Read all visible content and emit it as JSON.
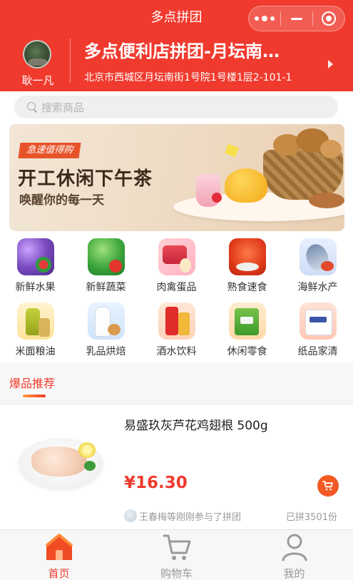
{
  "header": {
    "title": "多点拼团",
    "leader_name": "耿一凡",
    "shop_name": "多点便利店拼团-月坛南…",
    "address": "北京市西城区月坛南街1号院1号楼1层2-101-1"
  },
  "search": {
    "placeholder": "搜索商品"
  },
  "banner": {
    "tag": "急速值得购",
    "headline": "开工休闲下午茶",
    "subline": "唤醒你的每一天"
  },
  "categories": [
    {
      "label": "新鲜水果",
      "icon": "fruit-icon"
    },
    {
      "label": "新鲜蔬菜",
      "icon": "vegetable-icon"
    },
    {
      "label": "肉禽蛋品",
      "icon": "meat-icon"
    },
    {
      "label": "熟食速食",
      "icon": "cooked-food-icon"
    },
    {
      "label": "海鲜水产",
      "icon": "seafood-icon"
    },
    {
      "label": "米面粮油",
      "icon": "grain-oil-icon"
    },
    {
      "label": "乳品烘焙",
      "icon": "dairy-bakery-icon"
    },
    {
      "label": "酒水饮料",
      "icon": "drinks-icon"
    },
    {
      "label": "休闲零食",
      "icon": "snacks-icon"
    },
    {
      "label": "纸品家清",
      "icon": "paper-cleaning-icon"
    }
  ],
  "hot": {
    "title": "爆品推荐"
  },
  "product": {
    "name": "易盛玖灰芦花鸡翅根 500g",
    "price": "¥16.30",
    "joined_text": "王春梅等刚刚参与了拼团",
    "sold_text": "已拼3501份"
  },
  "tabs": [
    {
      "label": "首页",
      "active": true
    },
    {
      "label": "购物车",
      "active": false
    },
    {
      "label": "我的",
      "active": false
    }
  ],
  "colors": {
    "brand_red": "#f03a2e",
    "accent_orange": "#f15a24"
  }
}
